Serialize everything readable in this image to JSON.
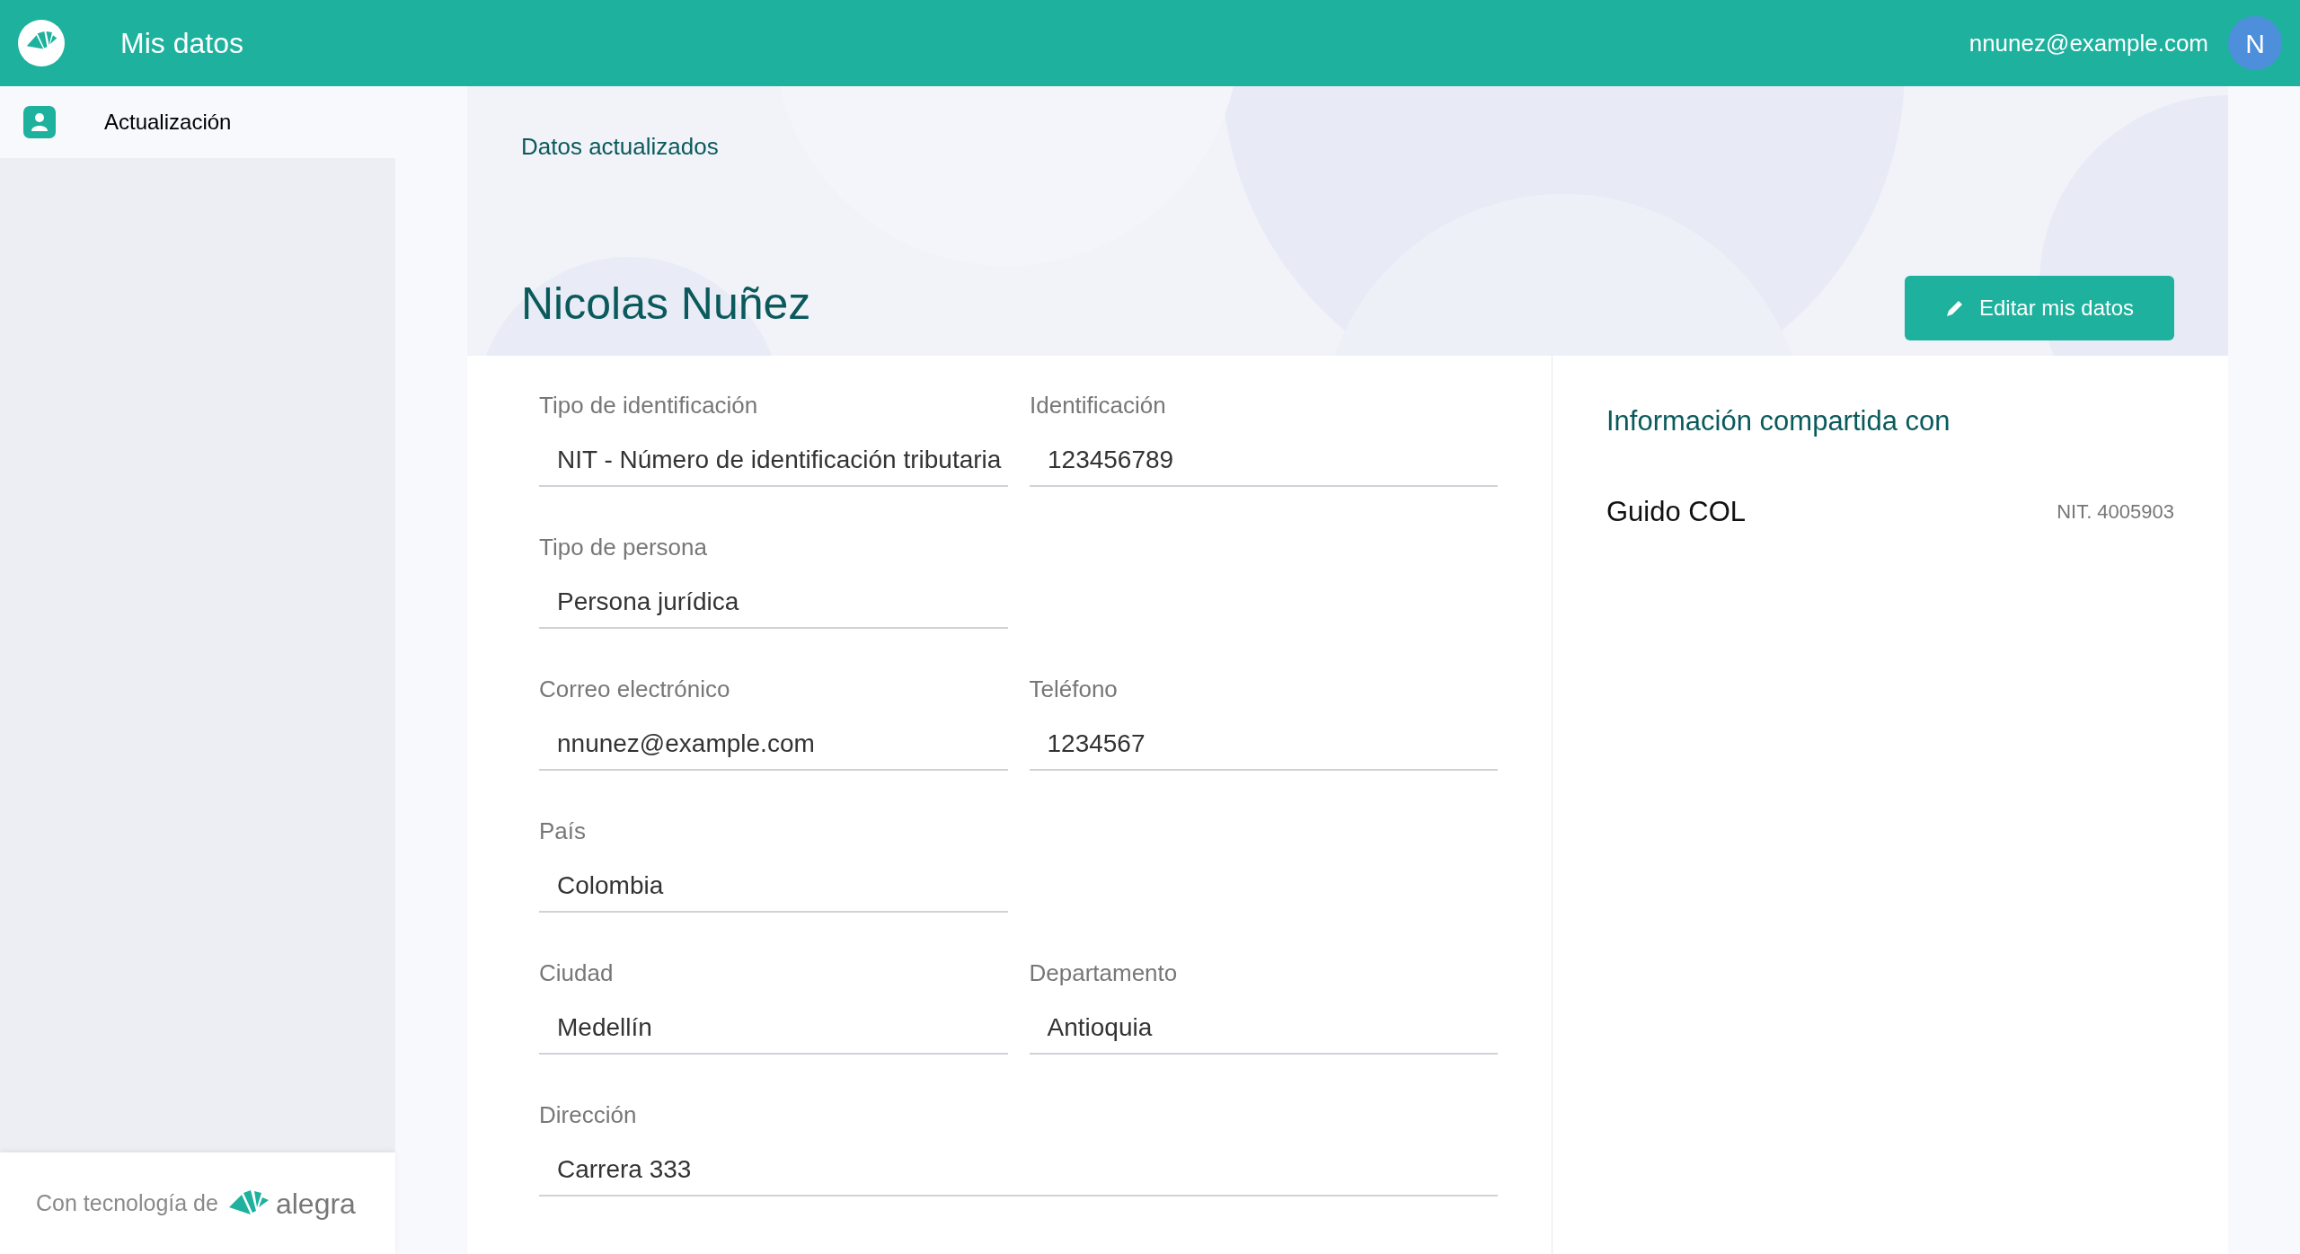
{
  "header": {
    "title": "Mis datos",
    "user_email": "nnunez@example.com",
    "avatar_initial": "N"
  },
  "sidebar": {
    "items": [
      {
        "label": "Actualización",
        "selected": true
      }
    ],
    "footer": {
      "text": "Con tecnología de",
      "brand": "alegra"
    }
  },
  "hero": {
    "status": "Datos actualizados",
    "name": "Nicolas Nuñez",
    "edit_button": "Editar mis datos"
  },
  "form": {
    "rows": [
      [
        {
          "label": "Tipo de identificación",
          "value": "NIT - Número de identificación tributaria",
          "kind": "half"
        },
        {
          "label": "Identificación",
          "value": "123456789",
          "kind": "half"
        }
      ],
      [
        {
          "label": "Tipo de persona",
          "value": "Persona jurídica",
          "kind": "half"
        }
      ],
      [
        {
          "label": "Correo electrónico",
          "value": "nnunez@example.com",
          "kind": "half"
        },
        {
          "label": "Teléfono",
          "value": "1234567",
          "kind": "half"
        }
      ],
      [
        {
          "label": "País",
          "value": "Colombia",
          "kind": "half"
        }
      ],
      [
        {
          "label": "Ciudad",
          "value": "Medellín",
          "kind": "half"
        },
        {
          "label": "Departamento",
          "value": "Antioquia",
          "kind": "half"
        }
      ],
      [
        {
          "label": "Dirección",
          "value": "Carrera 333",
          "kind": "wide"
        }
      ]
    ]
  },
  "shared": {
    "title": "Información compartida con",
    "companies": [
      {
        "name": "Guido COL",
        "id": "NIT. 4005903"
      }
    ]
  }
}
